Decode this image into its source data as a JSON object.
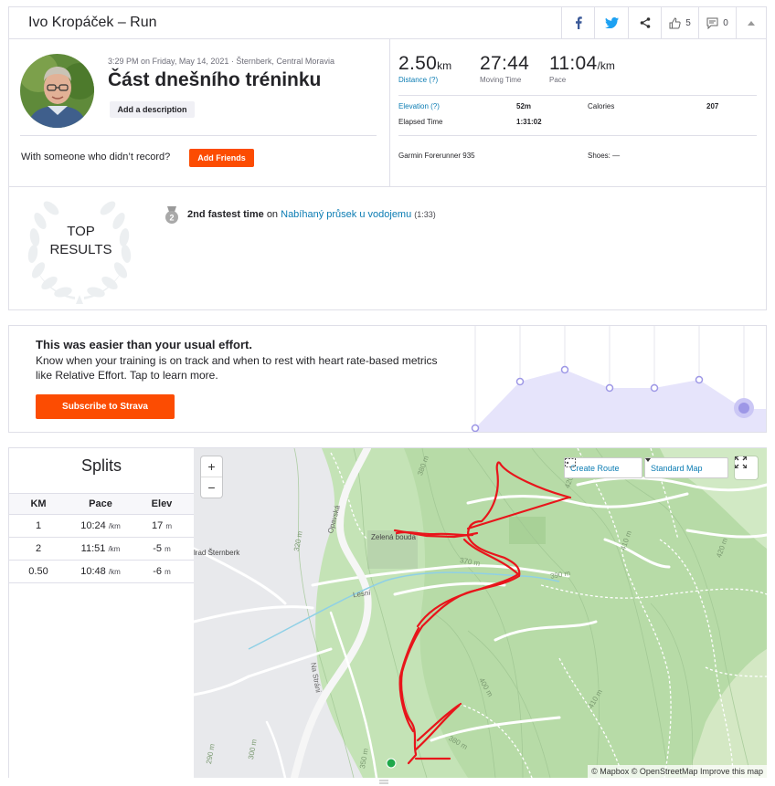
{
  "header": {
    "title": "Ivo Kropáček – Run",
    "kudos_count": "5",
    "comments_count": "0"
  },
  "activity": {
    "meta": "3:29 PM on Friday, May 14, 2021 · Šternberk, Central Moravia",
    "title": "Část dnešního tréninku",
    "add_description": "Add a description",
    "with_someone": "With someone who didn’t record?",
    "add_friends": "Add Friends"
  },
  "stats": {
    "distance": {
      "value": "2.50",
      "unit": "km",
      "label": "Distance (?)"
    },
    "moving_time": {
      "value": "27:44",
      "label": "Moving Time"
    },
    "pace": {
      "value": "11:04",
      "unit": "/km",
      "label": "Pace"
    },
    "elevation_label": "Elevation (?)",
    "elevation_value": "52m",
    "calories_label": "Calories",
    "calories_value": "207",
    "elapsed_label": "Elapsed Time",
    "elapsed_value": "1:31:02",
    "device": "Garmin Forerunner 935",
    "shoes": "Shoes: —"
  },
  "top_results": {
    "badge_line1": "TOP",
    "badge_line2": "RESULTS",
    "medal": "2",
    "achievement": "2nd fastest time",
    "on": "on",
    "segment": "Nabíhaný průsek u vodojemu",
    "time": "(1:33)"
  },
  "effort": {
    "title": "This was easier than your usual effort.",
    "body": "Know when your training is on track and when to rest with heart rate-based metrics like Relative Effort. Tap to learn more.",
    "button": "Subscribe to Strava",
    "colors": {
      "fill": "#e6e4fb",
      "point": "#9d97e6"
    }
  },
  "splits": {
    "title": "Splits",
    "headers": [
      "KM",
      "Pace",
      "Elev"
    ],
    "rows": [
      {
        "km": "1",
        "pace": "10:24",
        "pace_unit": "/km",
        "elev": "17",
        "elev_unit": "m"
      },
      {
        "km": "2",
        "pace": "11:51",
        "pace_unit": "/km",
        "elev": "-5",
        "elev_unit": "m"
      },
      {
        "km": "0.50",
        "pace": "10:48",
        "pace_unit": "/km",
        "elev": "-6",
        "elev_unit": "m"
      }
    ]
  },
  "map": {
    "zoom_in": "+",
    "zoom_out": "−",
    "create_route": "Create Route",
    "map_style": "Standard Map",
    "attribution": "© Mapbox © OpenStreetMap Improve this map",
    "labels": {
      "zelena": "Zelená bouda",
      "sternberk": "lrad Šternberk",
      "opavska": "Opavská",
      "lesni": "Lesní",
      "nastrani": "Na Stráni",
      "c320": "320 m",
      "c370": "370 m",
      "c380": "380 m",
      "c390": "390 m",
      "c400": "400 m",
      "c410": "410 m",
      "c420": "420 m",
      "c430": "430 m",
      "c350": "350 m",
      "c290": "290 m",
      "c300": "300 m"
    },
    "colors": {
      "route": "#e8151b",
      "start": "#1ea84a",
      "forest": "#c2e2b3"
    }
  },
  "colors": {
    "brand": "#fc4c02",
    "link": "#0b7cb3"
  }
}
